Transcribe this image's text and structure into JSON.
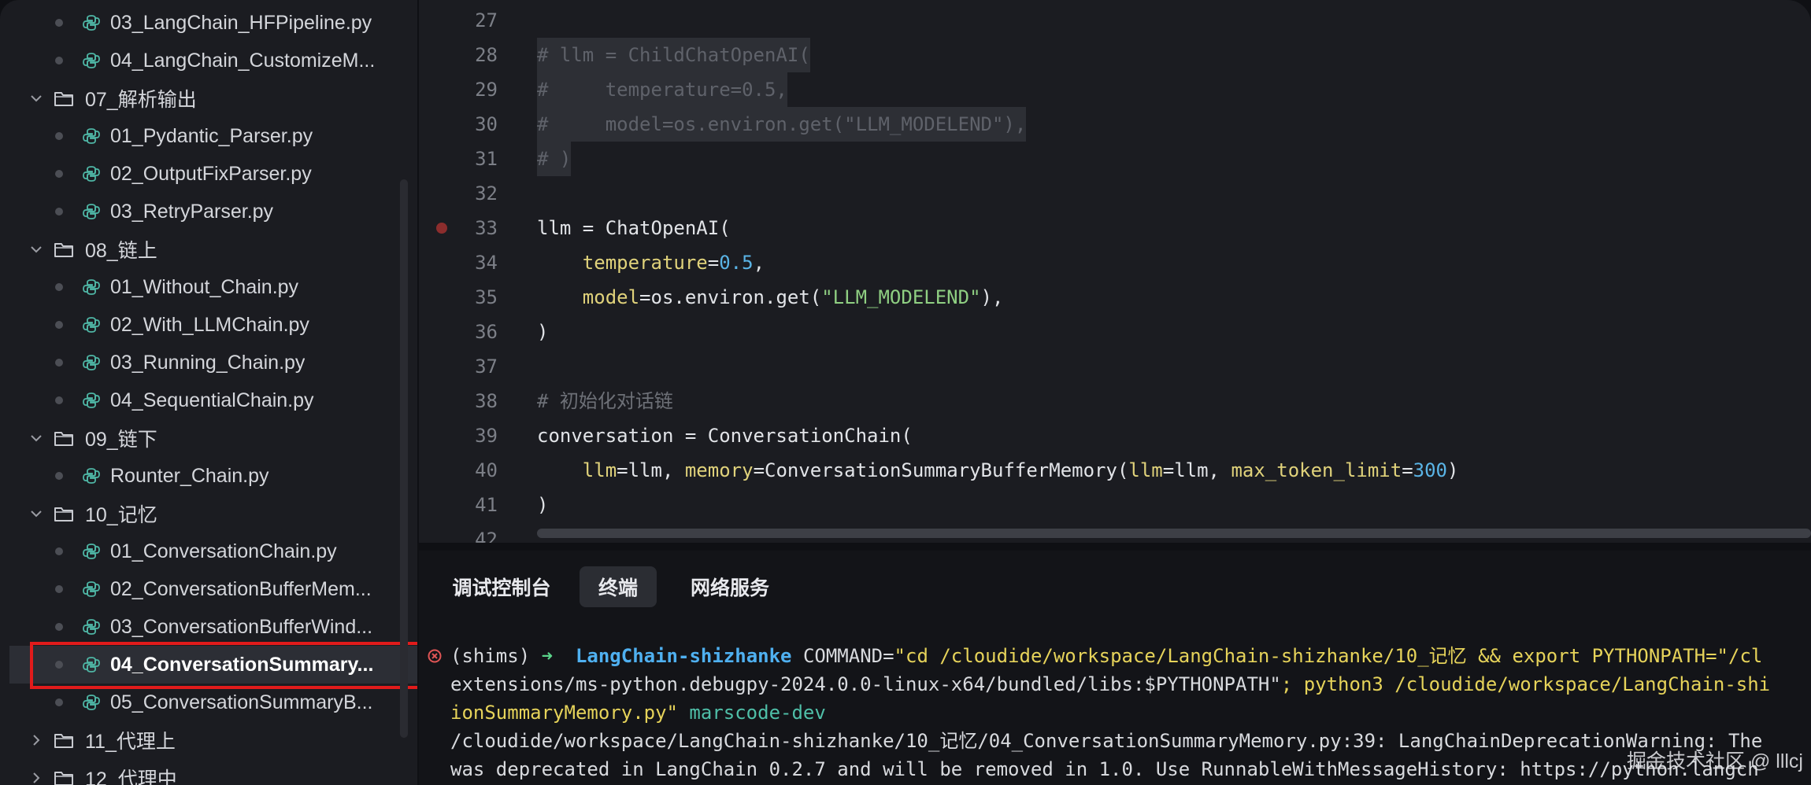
{
  "sidebar": {
    "rows": [
      {
        "kind": "file",
        "label": "03_LangChain_HFPipeline.py",
        "indent": 1
      },
      {
        "kind": "file",
        "label": "04_LangChain_CustomizeM...",
        "indent": 1
      },
      {
        "kind": "folder",
        "label": "07_解析输出",
        "indent": 0
      },
      {
        "kind": "file",
        "label": "01_Pydantic_Parser.py",
        "indent": 1
      },
      {
        "kind": "file",
        "label": "02_OutputFixParser.py",
        "indent": 1
      },
      {
        "kind": "file",
        "label": "03_RetryParser.py",
        "indent": 1
      },
      {
        "kind": "folder",
        "label": "08_链上",
        "indent": 0
      },
      {
        "kind": "file",
        "label": "01_Without_Chain.py",
        "indent": 1
      },
      {
        "kind": "file",
        "label": "02_With_LLMChain.py",
        "indent": 1
      },
      {
        "kind": "file",
        "label": "03_Running_Chain.py",
        "indent": 1
      },
      {
        "kind": "file",
        "label": "04_SequentialChain.py",
        "indent": 1
      },
      {
        "kind": "folder",
        "label": "09_链下",
        "indent": 0
      },
      {
        "kind": "file",
        "label": "Rounter_Chain.py",
        "indent": 1
      },
      {
        "kind": "folder",
        "label": "10_记忆",
        "indent": 0
      },
      {
        "kind": "file",
        "label": "01_ConversationChain.py",
        "indent": 1
      },
      {
        "kind": "file",
        "label": "02_ConversationBufferMem...",
        "indent": 1
      },
      {
        "kind": "file",
        "label": "03_ConversationBufferWind...",
        "indent": 1
      },
      {
        "kind": "file",
        "label": "04_ConversationSummary...",
        "indent": 1,
        "selected": true
      },
      {
        "kind": "file",
        "label": "05_ConversationSummaryB...",
        "indent": 1
      },
      {
        "kind": "folder",
        "label": "11_代理上",
        "indent": 0,
        "collapsed": true
      },
      {
        "kind": "folder",
        "label": "12_代理中",
        "indent": 0,
        "collapsed": true
      }
    ]
  },
  "editor": {
    "lines": [
      {
        "n": "27",
        "tokens": []
      },
      {
        "n": "28",
        "commented": true,
        "tokens": [
          [
            "cmt",
            "# llm = ChildChatOpenAI("
          ]
        ]
      },
      {
        "n": "29",
        "commented": true,
        "tokens": [
          [
            "cmt",
            "#     temperature=0.5,"
          ]
        ]
      },
      {
        "n": "30",
        "commented": true,
        "tokens": [
          [
            "cmt",
            "#     model=os.environ.get(\"LLM_MODELEND\"),"
          ]
        ]
      },
      {
        "n": "31",
        "commented": true,
        "tokens": [
          [
            "cmt",
            "# )"
          ]
        ]
      },
      {
        "n": "32",
        "tokens": []
      },
      {
        "n": "33",
        "breakpoint": true,
        "tokens": [
          [
            "plain",
            "llm = ChatOpenAI("
          ]
        ]
      },
      {
        "n": "34",
        "tokens": [
          [
            "plain",
            "    "
          ],
          [
            "param",
            "temperature"
          ],
          [
            "plain",
            "="
          ],
          [
            "num",
            "0.5"
          ],
          [
            "plain",
            ","
          ]
        ]
      },
      {
        "n": "35",
        "tokens": [
          [
            "plain",
            "    "
          ],
          [
            "param",
            "model"
          ],
          [
            "plain",
            "=os.environ.get("
          ],
          [
            "str",
            "\"LLM_MODELEND\""
          ],
          [
            "plain",
            "),"
          ]
        ]
      },
      {
        "n": "36",
        "tokens": [
          [
            "plain",
            ")"
          ]
        ]
      },
      {
        "n": "37",
        "tokens": []
      },
      {
        "n": "38",
        "tokens": [
          [
            "cmt",
            "# 初始化对话链"
          ]
        ]
      },
      {
        "n": "39",
        "tokens": [
          [
            "plain",
            "conversation = ConversationChain("
          ]
        ]
      },
      {
        "n": "40",
        "tokens": [
          [
            "plain",
            "    "
          ],
          [
            "param",
            "llm"
          ],
          [
            "plain",
            "=llm, "
          ],
          [
            "param",
            "memory"
          ],
          [
            "plain",
            "=ConversationSummaryBufferMemory("
          ],
          [
            "param",
            "llm"
          ],
          [
            "plain",
            "=llm, "
          ],
          [
            "param",
            "max_token_limit"
          ],
          [
            "plain",
            "="
          ],
          [
            "num",
            "300"
          ],
          [
            "plain",
            ")"
          ]
        ]
      },
      {
        "n": "41",
        "tokens": [
          [
            "plain",
            ")"
          ]
        ]
      },
      {
        "n": "42",
        "tokens": []
      }
    ]
  },
  "panel": {
    "tabs": [
      {
        "label": "调试控制台",
        "active": false
      },
      {
        "label": "终端",
        "active": true
      },
      {
        "label": "网络服务",
        "active": false
      }
    ],
    "terminal": [
      [
        [
          "plain",
          "(shims) "
        ],
        [
          "green",
          "➜  "
        ],
        [
          "cyan",
          "LangChain-shizhanke"
        ],
        [
          "plain",
          " COMMAND="
        ],
        [
          "yellow",
          "\"cd /cloudide/workspace/LangChain-shizhanke/10_记忆 && export PYTHONPATH=\"/cl"
        ]
      ],
      [
        [
          "plain",
          "extensions/ms-python.debugpy-2024.0.0-linux-x64/bundled/libs:$PYTHONPATH\""
        ],
        [
          "yellow",
          "; python3 /cloudide/workspace/LangChain-shi"
        ]
      ],
      [
        [
          "yellow",
          "ionSummaryMemory.py\""
        ],
        [
          "teal",
          " marscode-dev"
        ]
      ],
      [
        [
          "plain",
          "/cloudide/workspace/LangChain-shizhanke/10_记忆/04_ConversationSummaryMemory.py:39: LangChainDeprecationWarning: The"
        ]
      ],
      [
        [
          "plain",
          "was deprecated in LangChain 0.2.7 and will be removed in 1.0. Use RunnableWithMessageHistory: https://python.langch"
        ]
      ]
    ]
  },
  "watermark": "掘金技术社区 @ lllcj"
}
